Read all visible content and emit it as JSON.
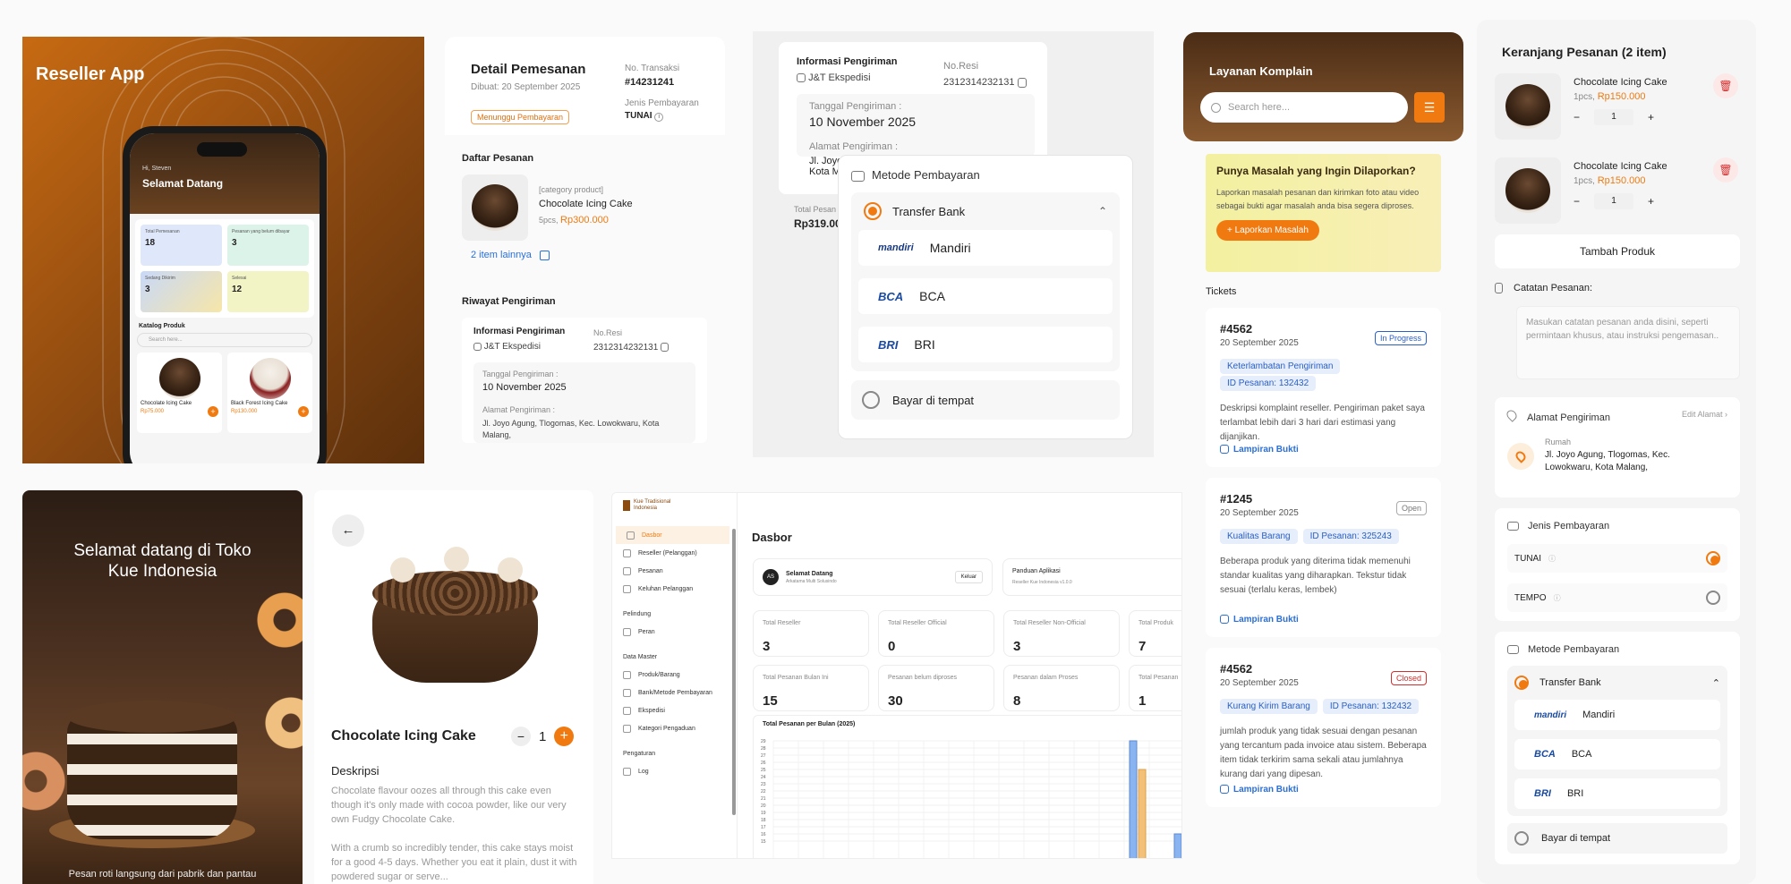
{
  "reseller": {
    "title": "Reseller App",
    "greet_small": "Hi, Steven",
    "greet": "Selamat Datang",
    "stats": [
      {
        "label": "Total Pemesanan",
        "value": "18"
      },
      {
        "label": "Pesanan yang belum dibayar",
        "value": "3"
      },
      {
        "label": "Sedang Dikirim",
        "value": "3"
      },
      {
        "label": "Selesai",
        "value": "12"
      }
    ],
    "catalog": "Katalog Produk",
    "search": "Search here...",
    "products": [
      {
        "name": "Chocolate Icing Cake",
        "price": "Rp75.000"
      },
      {
        "name": "Black Forest Icing Cake",
        "price": "Rp130.000"
      }
    ]
  },
  "detail": {
    "title": "Detail Pemesanan",
    "created": "Dibuat: 20 September 2025",
    "status": "Menunggu Pembayaran",
    "trx_label": "No. Transaksi",
    "trx": "#14231241",
    "pay_label": "Jenis Pembayaran",
    "pay": "TUNAI",
    "list_title": "Daftar Pesanan",
    "category": "[category product]",
    "product": "Chocolate Icing Cake",
    "qty": "5pcs,",
    "price": "Rp300.000",
    "more": "2 item lainnya",
    "history": "Riwayat Pengiriman",
    "ship_info": "Informasi Pengiriman",
    "courier": "J&T Ekspedisi",
    "resi_label": "No.Resi",
    "resi": "2312314232131",
    "date_label": "Tanggal Pengiriman :",
    "date": "10 November 2025",
    "addr_label": "Alamat Pengiriman :",
    "addr": "Jl. Joyo Agung, Tlogomas, Kec. Lowokwaru, Kota Malang,"
  },
  "payment": {
    "ship_info": "Informasi Pengiriman",
    "courier": "J&T Ekspedisi",
    "resi_label": "No.Resi",
    "resi": "2312314232131",
    "date_label": "Tanggal Pengiriman :",
    "date": "10 November 2025",
    "addr_label": "Alamat Pengiriman :",
    "addr1": "Jl. Joyo",
    "addr2": "Kota M",
    "total_label": "Total Pesan",
    "total": "Rp319.00",
    "method_title": "Metode Pembayaran",
    "transfer": "Transfer Bank",
    "banks": [
      "Mandiri",
      "BCA",
      "BRI"
    ],
    "bank_logos": [
      "mandiri",
      "BCA",
      "BRI"
    ],
    "cod": "Bayar di tempat"
  },
  "complaint": {
    "title": "Layanan Komplain",
    "search": "Search here...",
    "prompt_title": "Punya Masalah yang Ingin Dilaporkan?",
    "prompt_text": "Laporkan masalah pesanan dan kirimkan foto atau video sebagai bukti agar masalah anda bisa segera diproses.",
    "report_btn": "+ Laporkan Masalah",
    "tickets_label": "Tickets",
    "attach": "Lampiran Bukti",
    "tickets": [
      {
        "id": "#4562",
        "date": "20 September 2025",
        "status": "In Progress",
        "tag1": "Keterlambatan Pengiriman",
        "tag2": "ID Pesanan: 132432",
        "desc": "Deskripsi komplaint reseller. Pengiriman paket saya terlambat lebih dari 3 hari dari estimasi yang dijanjikan."
      },
      {
        "id": "#1245",
        "date": "20 September 2025",
        "status": "Open",
        "tag1": "Kualitas Barang",
        "tag2": "ID Pesanan: 325243",
        "desc": "Beberapa produk yang diterima tidak memenuhi standar kualitas yang diharapkan. Tekstur tidak sesuai (terlalu keras, lembek)"
      },
      {
        "id": "#4562",
        "date": "20 September 2025",
        "status": "Closed",
        "tag1": "Kurang Kirim Barang",
        "tag2": "ID Pesanan: 132432",
        "desc": " jumlah produk yang tidak sesuai dengan pesanan yang tercantum pada invoice atau sistem. Beberapa item tidak terkirim sama sekali atau jumlahnya kurang dari yang dipesan."
      }
    ]
  },
  "cart": {
    "title": "Keranjang Pesanan (2 item)",
    "items": [
      {
        "name": "Chocolate Icing Cake",
        "qty_text": "1pcs,",
        "price": "Rp150.000",
        "qty": "1"
      },
      {
        "name": "Chocolate Icing Cake",
        "qty_text": "1pcs,",
        "price": "Rp150.000",
        "qty": "1"
      }
    ],
    "add": "Tambah Produk",
    "note_label": "Catatan Pesanan:",
    "note_ph": "Masukan catatan pesanan anda disini, seperti permintaan khusus, atau instruksi pengemasan..",
    "addr_title": "Alamat Pengiriman",
    "edit_addr": "Edit Alamat",
    "addr_tag": "Rumah",
    "addr": "Jl. Joyo Agung, Tlogomas, Kec. Lowokwaru, Kota Malang,",
    "pay_type_title": "Jenis Pembayaran",
    "tunai": "TUNAI",
    "tempo": "TEMPO",
    "method_title": "Metode Pembayaran",
    "transfer": "Transfer Bank",
    "banks": [
      "Mandiri",
      "BCA",
      "BRI"
    ],
    "bank_logos": [
      "mandiri",
      "BCA",
      "BRI"
    ],
    "cod": "Bayar di tempat"
  },
  "welcome": {
    "title": "Selamat datang di Toko Kue Indonesia",
    "bottom": "Pesan roti langsung dari pabrik dan pantau"
  },
  "product": {
    "name": "Chocolate Icing Cake",
    "qty": "1",
    "desc_title": "Deskripsi",
    "desc1": "Chocolate flavour oozes all through this cake even though it's only made with cocoa powder, like our very own Fudgy Chocolate Cake.",
    "desc2": "With a crumb so incredibly tender, this cake stays moist for a good 4-5 days. Whether you eat it plain, dust it with powdered sugar or serve..."
  },
  "dash": {
    "brand": "Kue Tradisional Indonesia",
    "title": "Dasbor",
    "welcome": "Selamat Datang",
    "company": "Arkatama Multi Solusindo",
    "logout": "Keluar",
    "guide": "Panduan Aplikasi",
    "guide_sub": "Reseller Kue Indonesia v1.0.0",
    "menu": [
      "Dasbor",
      "Reseller (Pelanggan)",
      "Pesanan",
      "Keluhan Pelanggan"
    ],
    "sec1": "Pelindung",
    "menu2": [
      "Peran"
    ],
    "sec2": "Data Master",
    "menu3": [
      "Produk/Barang",
      "Bank/Metode Pembayaran",
      "Ekspedisi",
      "Kategori Pengaduan"
    ],
    "sec3": "Pengaturan",
    "menu4": [
      "Log"
    ],
    "stats1": [
      {
        "label": "Total Reseller",
        "value": "3"
      },
      {
        "label": "Total Reseller Official",
        "value": "0"
      },
      {
        "label": "Total Reseller Non-Official",
        "value": "3"
      },
      {
        "label": "Total Produk",
        "value": "7"
      }
    ],
    "stats2": [
      {
        "label": "Total Pesanan Bulan Ini",
        "value": "15"
      },
      {
        "label": "Pesanan belum diproses",
        "value": "30"
      },
      {
        "label": "Pesanan dalam Proses",
        "value": "8"
      },
      {
        "label": "Total Pesanan",
        "value": "1"
      }
    ],
    "chart_title": "Total Pesanan per Bulan (2025)",
    "initials": "AS"
  },
  "chart_data": {
    "type": "bar",
    "title": "Total Pesanan per Bulan (2025)",
    "yticks": [
      29,
      28,
      27,
      26,
      25,
      24,
      23,
      22,
      21,
      20,
      19,
      18,
      17,
      16,
      15
    ],
    "series": [
      {
        "color": "#8ab4f0",
        "values": [
          29,
          16
        ]
      },
      {
        "color": "#f2c078",
        "values": [
          25
        ]
      }
    ]
  },
  "colors": {
    "accent": "#f07a10",
    "brown": "#4a2c15"
  }
}
